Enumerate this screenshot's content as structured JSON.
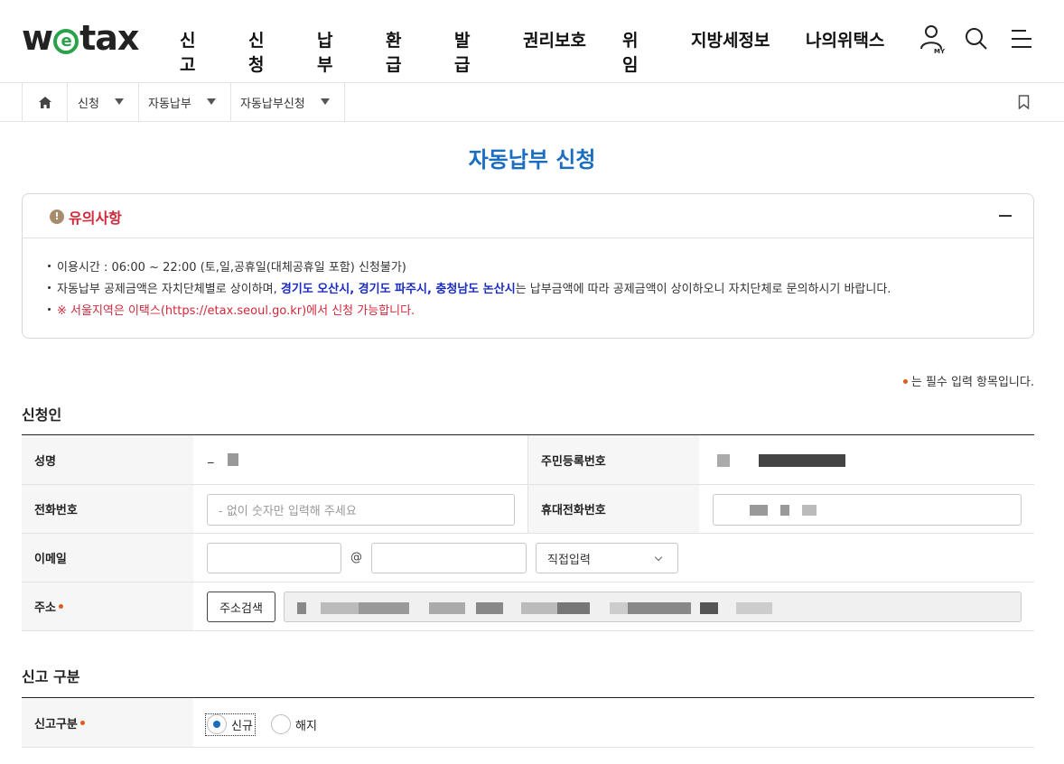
{
  "header": {
    "logo_prefix": "w",
    "logo_mid": "e",
    "logo_suffix": "tax",
    "nav": [
      "신고",
      "신청",
      "납부",
      "환급",
      "발급",
      "권리보호",
      "위임",
      "지방세정보",
      "나의위택스"
    ],
    "my_label": "MY"
  },
  "breadcrumb": {
    "items": [
      "신청",
      "자동납부",
      "자동납부신청"
    ]
  },
  "page_title": "자동납부 신청",
  "notice": {
    "title": "유의사항",
    "line1": "이용시간 : 06:00 ~ 22:00 (토,일,공휴일(대체공휴일 포함) 신청불가)",
    "line2_pre": "자동납부 공제금액은 자치단체별로 상이하며, ",
    "line2_bold": "경기도 오산시, 경기도 파주시, 충청남도 논산시",
    "line2_post": "는 납부금액에 따라 공제금액이 상이하오니 자치단체로 문의하시기 바랍니다.",
    "line3": "※ 서울지역은 이택스(https://etax.seoul.go.kr)에서 신청 가능합니다."
  },
  "required_note": "는 필수 입력 항목입니다.",
  "applicant": {
    "section_title": "신청인",
    "name_label": "성명",
    "name_value": "_",
    "rrn_label": "주민등록번호",
    "phone_label": "전화번호",
    "phone_placeholder": "- 없이 숫자만 입력해 주세요",
    "mobile_label": "휴대전화번호",
    "email_label": "이메일",
    "email_at": "@",
    "email_domain_select": "직접입력",
    "address_label": "주소",
    "address_search_button": "주소검색"
  },
  "report": {
    "section_title": "신고 구분",
    "type_label": "신고구분",
    "options": [
      "신규",
      "해지"
    ],
    "selected": "신규"
  },
  "colors": {
    "accent": "#1b6dc1",
    "warning": "#d0293a",
    "required": "#e05a1a",
    "logo_green": "#2aa24a"
  }
}
